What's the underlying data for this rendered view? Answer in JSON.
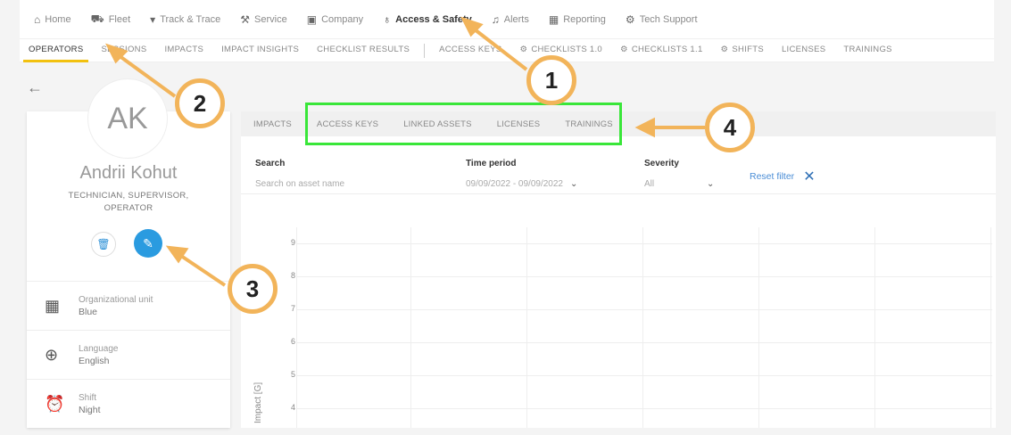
{
  "topnav": [
    {
      "icon": "home-icon",
      "glyph": "⌂",
      "label": "Home",
      "active": false
    },
    {
      "icon": "fleet-icon",
      "glyph": "⛟",
      "label": "Fleet",
      "active": false
    },
    {
      "icon": "location-pin-icon",
      "glyph": "▾",
      "label": "Track & Trace",
      "active": false
    },
    {
      "icon": "wrench-icon",
      "glyph": "⚒",
      "label": "Service",
      "active": false
    },
    {
      "icon": "company-icon",
      "glyph": "▣",
      "label": "Company",
      "active": false
    },
    {
      "icon": "key-icon",
      "glyph": "♁",
      "label": "Access & Safety",
      "active": true
    },
    {
      "icon": "bell-icon",
      "glyph": "♫",
      "label": "Alerts",
      "active": false
    },
    {
      "icon": "reporting-icon",
      "glyph": "▦",
      "label": "Reporting",
      "active": false
    },
    {
      "icon": "gear-icon",
      "glyph": "⚙",
      "label": "Tech Support",
      "active": false
    }
  ],
  "subtabs": {
    "operators": "OPERATORS",
    "sessions": "SESSIONS",
    "impacts": "IMPACTS",
    "impact_insights": "IMPACT INSIGHTS",
    "checklist_results": "CHECKLIST RESULTS",
    "access_keys": "ACCESS KEYS",
    "checklists_10": "CHECKLISTS 1.0",
    "checklists_11": "CHECKLISTS 1.1",
    "shifts": "SHIFTS",
    "licenses": "LICENSES",
    "trainings": "TRAININGS"
  },
  "profile": {
    "initials": "AK",
    "name": "Andrii Kohut",
    "roles": "TECHNICIAN, SUPERVISOR, OPERATOR",
    "org_label": "Organizational unit",
    "org_value": "Blue",
    "lang_label": "Language",
    "lang_value": "English",
    "shift_label": "Shift",
    "shift_value": "Night"
  },
  "content_tabs": {
    "impacts": "IMPACTS",
    "access_keys": "ACCESS KEYS",
    "linked_assets": "LINKED ASSETS",
    "licenses": "LICENSES",
    "trainings": "TRAININGS"
  },
  "filters": {
    "search_label": "Search",
    "search_placeholder": "Search on asset name",
    "time_label": "Time period",
    "time_value": "09/09/2022 - 09/09/2022",
    "severity_label": "Severity",
    "severity_value": "All",
    "reset_label": "Reset filter"
  },
  "chart_data": {
    "type": "scatter",
    "ylabel": "Impact [G]",
    "yticks": [
      9,
      8,
      7,
      6,
      5,
      4
    ],
    "series": []
  },
  "callouts": {
    "c1": "1",
    "c2": "2",
    "c3": "3",
    "c4": "4"
  },
  "colors": {
    "accent": "#f2c10f",
    "edit_button": "#2a9be0",
    "callout_ring": "#f2b45a",
    "highlight_box": "#39e639"
  }
}
